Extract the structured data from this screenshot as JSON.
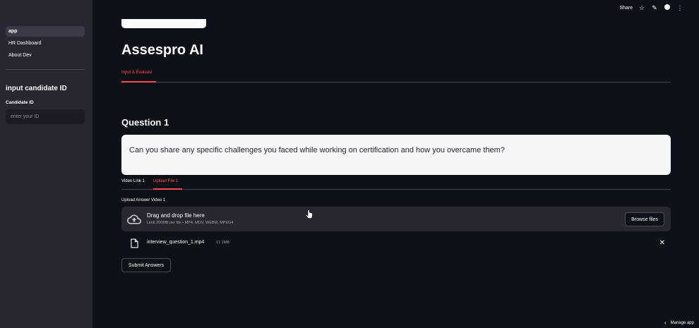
{
  "sidebar": {
    "nav": [
      {
        "label": "app",
        "active": true
      },
      {
        "label": "HR Dashboard",
        "active": false
      },
      {
        "label": "About Dev",
        "active": false
      }
    ],
    "section_title": "input candidate ID",
    "candidate_label": "Candidate ID",
    "candidate_placeholder": "enter your ID"
  },
  "toolbar": {
    "share_label": "Share",
    "icons": [
      "star-icon",
      "edit-icon",
      "github-icon",
      "more-icon"
    ]
  },
  "main": {
    "title": "Assespro AI",
    "tab": "Input & Evaluasi",
    "question_title": "Question 1",
    "question_text": "Can you share any specific challenges you faced while working on certification and how you overcame them?",
    "subtabs": [
      "Video Link 1",
      "Upload File 1"
    ],
    "active_subtab": "Upload File 1",
    "upload_label": "Upload Answer Video 1",
    "dropzone": {
      "title": "Drag and drop file here",
      "limit": "Limit 200MB per file • MP4, MOV, WEBM, MPEG4",
      "browse_label": "Browse files"
    },
    "file": {
      "name": "interview_question_1.mp4",
      "size": "17.1MB"
    },
    "submit_label": "Submit Answers"
  },
  "footer": {
    "manage_label": "Manage app"
  },
  "colors": {
    "background": "#0e1117",
    "sidebar": "#262730",
    "accent": "#ff4b4b"
  }
}
